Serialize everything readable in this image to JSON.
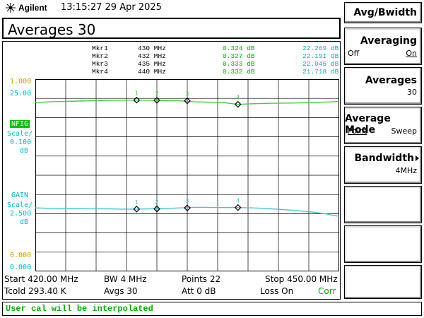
{
  "header": {
    "brand": "Agilent",
    "datetime": "13:15:27  29 Apr 2025",
    "title": "Averages 30"
  },
  "markers": [
    {
      "name": "Mkr1",
      "freq": "430 MHz",
      "nfig": "0.324 dB",
      "gain": "22.269 dB"
    },
    {
      "name": "Mkr2",
      "freq": "432 MHz",
      "nfig": "0.327 dB",
      "gain": "22.191 dB"
    },
    {
      "name": "Mkr3",
      "freq": "435 MHz",
      "nfig": "0.333 dB",
      "gain": "22.045 dB"
    },
    {
      "name": "Mkr4",
      "freq": "440 MHz",
      "nfig": "0.332 dB",
      "gain": "21.718 dB"
    }
  ],
  "scale": {
    "nfig_top": "1.000",
    "gain_top": "25.00",
    "nfig_label": "NFIG",
    "nfig_scale": "Scale/",
    "nfig_scale_val": "0.100",
    "nfig_unit": "dB",
    "gain_label": "GAIN",
    "gain_scale": "Scale/",
    "gain_scale_val": "2.500",
    "gain_unit": "dB",
    "nfig_bottom": "0.000",
    "gain_bottom": "0.000"
  },
  "chart_data": {
    "type": "line",
    "x": [
      420,
      421.43,
      422.86,
      424.29,
      425.71,
      427.14,
      428.57,
      430,
      431.43,
      432.86,
      434.29,
      435.71,
      437.14,
      438.57,
      440,
      441.43,
      442.86,
      444.29,
      445.71,
      447.14,
      448.57,
      450
    ],
    "xlim": [
      420,
      450
    ],
    "series": [
      {
        "name": "NFIG",
        "color": "#40c8d8",
        "values": [
          0.33,
          0.328,
          0.327,
          0.326,
          0.325,
          0.325,
          0.324,
          0.324,
          0.325,
          0.327,
          0.33,
          0.333,
          0.333,
          0.332,
          0.332,
          0.33,
          0.327,
          0.322,
          0.317,
          0.31,
          0.3,
          0.286
        ],
        "ylim": [
          0.0,
          1.0
        ]
      },
      {
        "name": "GAIN",
        "color": "#40d040",
        "values": [
          21.95,
          22.05,
          22.1,
          22.15,
          22.2,
          22.24,
          22.26,
          22.27,
          22.25,
          22.2,
          22.18,
          22.05,
          22.0,
          21.95,
          21.72,
          21.8,
          21.85,
          21.88,
          21.9,
          21.95,
          22.0,
          22.1
        ],
        "ylim": [
          0.0,
          25.0
        ]
      }
    ],
    "markers": [
      {
        "label": "1",
        "x": 430
      },
      {
        "label": "2",
        "x": 432
      },
      {
        "label": "3",
        "x": 435
      },
      {
        "label": "4",
        "x": 440
      }
    ],
    "grid": true
  },
  "footer": {
    "start": "Start 420.00 MHz",
    "bw": "BW 4 MHz",
    "points": "Points 22",
    "stop": "Stop 450.00 MHz",
    "tcold": "Tcold 293.40 K",
    "avgs": "Avgs 30",
    "att": "Att 0 dB",
    "loss": "Loss On",
    "corr": "Corr"
  },
  "status": "User cal will be interpolated",
  "softkeys": {
    "menu_title": "Avg/Bwidth",
    "averaging": {
      "label": "Averaging",
      "off": "Off",
      "on": "On"
    },
    "averages": {
      "label": "Averages",
      "value": "30"
    },
    "avg_mode": {
      "label": "Average Mode",
      "point": "Point",
      "sweep": "Sweep"
    },
    "bandwidth": {
      "label": "Bandwidth",
      "value": "4MHz"
    }
  }
}
